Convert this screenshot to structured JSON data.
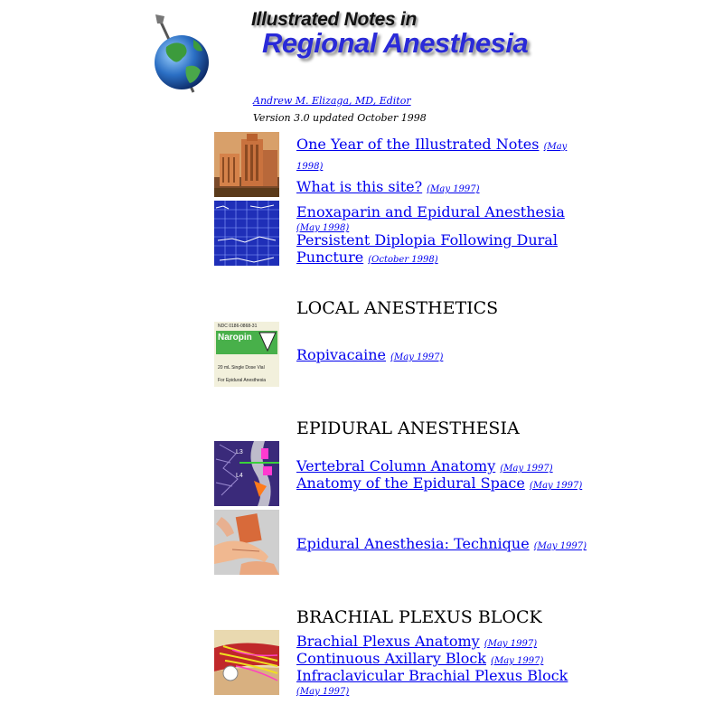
{
  "header": {
    "title_line1": "Illustrated Notes in",
    "title_line2": "Regional Anesthesia",
    "editor_link": "Andrew M. Elizaga, MD, Editor",
    "version": "Version 3.0 updated October 1998"
  },
  "intro_links": [
    {
      "title": "One Year of the Illustrated Notes",
      "date": "(May 1998)"
    },
    {
      "title": "What is this site?",
      "date": "(May 1997)"
    },
    {
      "title": "Enoxaparin and Epidural Anesthesia",
      "date": "(May 1998)"
    },
    {
      "title": "Persistent Diplopia Following Dural Puncture",
      "date": "(October 1998)"
    }
  ],
  "sections": [
    {
      "heading": "LOCAL ANESTHETICS",
      "links": [
        {
          "title": "Ropivacaine",
          "date": "(May 1997)"
        }
      ]
    },
    {
      "heading": "EPIDURAL ANESTHESIA",
      "links": [
        {
          "title": "Vertebral Column Anatomy",
          "date": "(May 1997)"
        },
        {
          "title": "Anatomy of the Epidural Space",
          "date": "(May 1997)"
        },
        {
          "title": "Epidural Anesthesia: Technique",
          "date": "(May 1997)"
        }
      ]
    },
    {
      "heading": "BRACHIAL PLEXUS BLOCK",
      "links": [
        {
          "title": "Brachial Plexus Anatomy",
          "date": "(May 1997)"
        },
        {
          "title": "Continuous Axillary Block",
          "date": "(May 1997)"
        },
        {
          "title": "Infraclavicular Brachial Plexus Block",
          "date": "(May 1997)"
        }
      ]
    }
  ],
  "images": {
    "globe": "globe-with-pin-logo",
    "building": "hospital-building-photo",
    "chart": "blue-graph-paper-image",
    "naropin": "naropin-vial-label",
    "naropin_brand": "Naropin",
    "naropin_lines": [
      "NDC 0186-0868-31",
      "20 mL Single Dose Vial",
      "For Epidural Anesthesia"
    ],
    "spine": "lumbar-spine-illustration",
    "hands": "epidural-technique-hands",
    "plexus": "brachial-plexus-illustration"
  }
}
